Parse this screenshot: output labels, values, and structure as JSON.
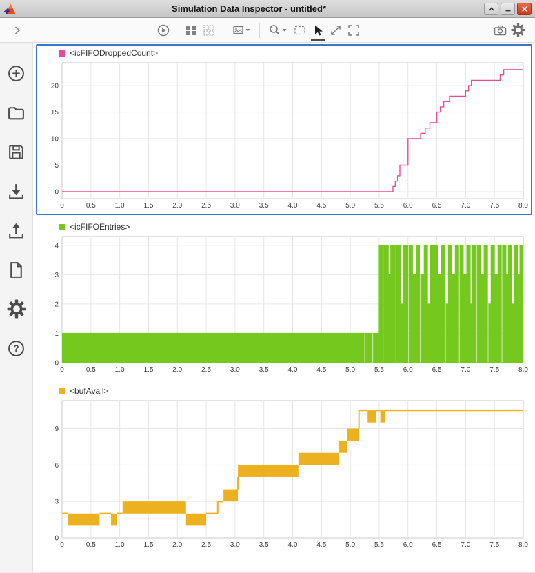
{
  "window": {
    "title": "Simulation Data Inspector - untitled*",
    "app_icon": "matlab-logo",
    "controls": [
      {
        "name": "shade",
        "icon": "chevron-up-icon"
      },
      {
        "name": "minimize",
        "icon": "minus-icon"
      },
      {
        "name": "close",
        "icon": "x-icon"
      }
    ]
  },
  "toolbar": {
    "items": [
      {
        "name": "collapse-panel",
        "icon": "chevron-right-icon"
      },
      {
        "name": "run",
        "icon": "play-circle-icon"
      },
      {
        "name": "layout-grid",
        "icon": "grid-filled-icon"
      },
      {
        "name": "layout-custom",
        "icon": "grid-dashed-icon"
      },
      {
        "name": "export-image",
        "icon": "image-icon",
        "has_dropdown": true
      },
      {
        "name": "zoom",
        "icon": "magnifier-icon",
        "has_dropdown": true
      },
      {
        "name": "zoom-region",
        "icon": "dashed-rectangle-icon"
      },
      {
        "name": "pointer",
        "icon": "cursor-arrow-icon",
        "active": true
      },
      {
        "name": "fit-to-view",
        "icon": "diagonal-arrows-icon"
      },
      {
        "name": "fullscreen",
        "icon": "corner-brackets-icon"
      },
      {
        "name": "snapshot",
        "icon": "camera-icon"
      },
      {
        "name": "settings",
        "icon": "gear-icon"
      }
    ]
  },
  "sidebar": {
    "items": [
      {
        "name": "add",
        "icon": "plus-circle-icon"
      },
      {
        "name": "open",
        "icon": "folder-icon"
      },
      {
        "name": "save",
        "icon": "floppy-disk-icon"
      },
      {
        "name": "import",
        "icon": "arrow-down-tray-icon"
      },
      {
        "name": "export",
        "icon": "arrow-up-tray-icon"
      },
      {
        "name": "report",
        "icon": "document-icon"
      },
      {
        "name": "preferences",
        "icon": "gear-icon"
      },
      {
        "name": "help",
        "icon": "question-circle-icon"
      }
    ]
  },
  "chart_data": [
    {
      "type": "step",
      "legend": "<icFIFODroppedCount>",
      "color": "#e84a9b",
      "selected": true,
      "grid": true,
      "legend_position": "top-left",
      "xlim": [
        0,
        8
      ],
      "ylim": [
        -1.3,
        24.3
      ],
      "xticks": {
        "values": [
          0,
          0.5,
          1,
          1.5,
          2,
          2.5,
          3,
          3.5,
          4,
          4.5,
          5,
          5.5,
          6,
          6.5,
          7,
          7.5,
          8
        ],
        "labels": [
          "0",
          "0.5",
          "1.0",
          "1.5",
          "2.0",
          "2.5",
          "3.0",
          "3.5",
          "4.0",
          "4.5",
          "5.0",
          "5.5",
          "6.0",
          "6.5",
          "7.0",
          "7.5",
          "8.0"
        ]
      },
      "yticks": {
        "values": [
          0,
          5,
          10,
          15,
          20
        ],
        "labels": [
          "0",
          "5",
          "10",
          "15",
          "20"
        ]
      },
      "steps": [
        [
          0,
          0
        ],
        [
          5.74,
          1
        ],
        [
          5.78,
          2
        ],
        [
          5.82,
          3
        ],
        [
          5.86,
          5
        ],
        [
          6.0,
          10
        ],
        [
          6.22,
          11
        ],
        [
          6.3,
          12
        ],
        [
          6.38,
          13
        ],
        [
          6.5,
          15
        ],
        [
          6.56,
          16
        ],
        [
          6.62,
          17
        ],
        [
          6.72,
          18
        ],
        [
          7.0,
          19
        ],
        [
          7.05,
          20
        ],
        [
          7.1,
          21
        ],
        [
          7.6,
          22
        ],
        [
          7.66,
          23
        ]
      ]
    },
    {
      "type": "step-area",
      "legend": "<icFIFOEntries>",
      "color": "#74c81e",
      "selected": false,
      "grid": true,
      "legend_position": "top-left",
      "xlim": [
        0,
        8
      ],
      "ylim": [
        0,
        4.3
      ],
      "xticks": {
        "values": [
          0,
          0.5,
          1,
          1.5,
          2,
          2.5,
          3,
          3.5,
          4,
          4.5,
          5,
          5.5,
          6,
          6.5,
          7,
          7.5,
          8
        ],
        "labels": [
          "0",
          "0.5",
          "1.0",
          "1.5",
          "2.0",
          "2.5",
          "3.0",
          "3.5",
          "4.0",
          "4.5",
          "5.0",
          "5.5",
          "6.0",
          "6.5",
          "7.0",
          "7.5",
          "8.0"
        ]
      },
      "yticks": {
        "values": [
          0,
          1,
          2,
          3,
          4
        ],
        "labels": [
          "0",
          "1",
          "2",
          "3",
          "4"
        ]
      },
      "steps": [
        [
          0,
          1
        ],
        [
          5.24,
          0
        ],
        [
          5.26,
          1
        ],
        [
          5.38,
          0
        ],
        [
          5.4,
          1
        ],
        [
          5.5,
          4
        ],
        [
          5.56,
          0
        ],
        [
          5.58,
          4
        ],
        [
          5.66,
          3
        ],
        [
          5.7,
          4
        ],
        [
          5.78,
          0
        ],
        [
          5.8,
          4
        ],
        [
          5.88,
          2
        ],
        [
          5.92,
          4
        ],
        [
          6.0,
          0
        ],
        [
          6.02,
          4
        ],
        [
          6.08,
          3
        ],
        [
          6.14,
          4
        ],
        [
          6.2,
          0
        ],
        [
          6.22,
          3
        ],
        [
          6.28,
          4
        ],
        [
          6.34,
          2
        ],
        [
          6.38,
          4
        ],
        [
          6.44,
          0
        ],
        [
          6.46,
          4
        ],
        [
          6.52,
          3
        ],
        [
          6.58,
          4
        ],
        [
          6.64,
          0
        ],
        [
          6.66,
          2
        ],
        [
          6.7,
          4
        ],
        [
          6.76,
          3
        ],
        [
          6.82,
          4
        ],
        [
          6.88,
          0
        ],
        [
          6.9,
          4
        ],
        [
          6.96,
          3
        ],
        [
          7.02,
          4
        ],
        [
          7.08,
          2
        ],
        [
          7.12,
          4
        ],
        [
          7.18,
          0
        ],
        [
          7.2,
          4
        ],
        [
          7.26,
          3
        ],
        [
          7.32,
          4
        ],
        [
          7.38,
          0
        ],
        [
          7.4,
          2
        ],
        [
          7.44,
          4
        ],
        [
          7.5,
          3
        ],
        [
          7.56,
          4
        ],
        [
          7.62,
          0
        ],
        [
          7.64,
          4
        ],
        [
          7.7,
          3
        ],
        [
          7.74,
          4
        ],
        [
          7.8,
          2
        ],
        [
          7.84,
          4
        ],
        [
          7.9,
          3
        ],
        [
          7.94,
          4
        ]
      ]
    },
    {
      "type": "bands",
      "legend": "<bufAvail>",
      "color": "#edb120",
      "selected": false,
      "grid": true,
      "legend_position": "top-left",
      "xlim": [
        0,
        8
      ],
      "ylim": [
        0,
        11.3
      ],
      "xticks": {
        "values": [
          0,
          0.5,
          1,
          1.5,
          2,
          2.5,
          3,
          3.5,
          4,
          4.5,
          5,
          5.5,
          6,
          6.5,
          7,
          7.5,
          8
        ],
        "labels": [
          "0",
          "0.5",
          "1.0",
          "1.5",
          "2.0",
          "2.5",
          "3.0",
          "3.5",
          "4.0",
          "4.5",
          "5.0",
          "5.5",
          "6.0",
          "6.5",
          "7.0",
          "7.5",
          "8.0"
        ]
      },
      "yticks": {
        "values": [
          0,
          3,
          6,
          9
        ],
        "labels": [
          "0",
          "3",
          "6",
          "9"
        ]
      },
      "segments": [
        {
          "t0": 0.0,
          "t1": 0.1,
          "v": 2
        },
        {
          "t0": 0.1,
          "t1": 0.65,
          "lo": 1,
          "hi": 2
        },
        {
          "t0": 0.65,
          "t1": 0.85,
          "v": 2
        },
        {
          "t0": 0.85,
          "t1": 0.95,
          "lo": 1,
          "hi": 2
        },
        {
          "t0": 0.95,
          "t1": 1.05,
          "v": 2
        },
        {
          "t0": 1.05,
          "t1": 2.15,
          "lo": 2,
          "hi": 3
        },
        {
          "t0": 2.15,
          "t1": 2.5,
          "lo": 1,
          "hi": 2
        },
        {
          "t0": 2.5,
          "t1": 2.7,
          "v": 2
        },
        {
          "t0": 2.7,
          "t1": 2.8,
          "v": 3
        },
        {
          "t0": 2.8,
          "t1": 3.05,
          "lo": 3,
          "hi": 4
        },
        {
          "t0": 3.05,
          "t1": 4.1,
          "lo": 5,
          "hi": 6
        },
        {
          "t0": 4.1,
          "t1": 4.8,
          "lo": 6,
          "hi": 7
        },
        {
          "t0": 4.8,
          "t1": 4.95,
          "lo": 7,
          "hi": 8
        },
        {
          "t0": 4.95,
          "t1": 5.15,
          "lo": 8,
          "hi": 9
        },
        {
          "t0": 5.15,
          "t1": 5.3,
          "v": 10.5
        },
        {
          "t0": 5.3,
          "t1": 5.45,
          "lo": 9.5,
          "hi": 10.5
        },
        {
          "t0": 5.45,
          "t1": 5.52,
          "v": 10.5
        },
        {
          "t0": 5.52,
          "t1": 5.6,
          "lo": 9.5,
          "hi": 10.5
        },
        {
          "t0": 5.6,
          "t1": 8.0,
          "v": 10.5
        }
      ]
    }
  ]
}
